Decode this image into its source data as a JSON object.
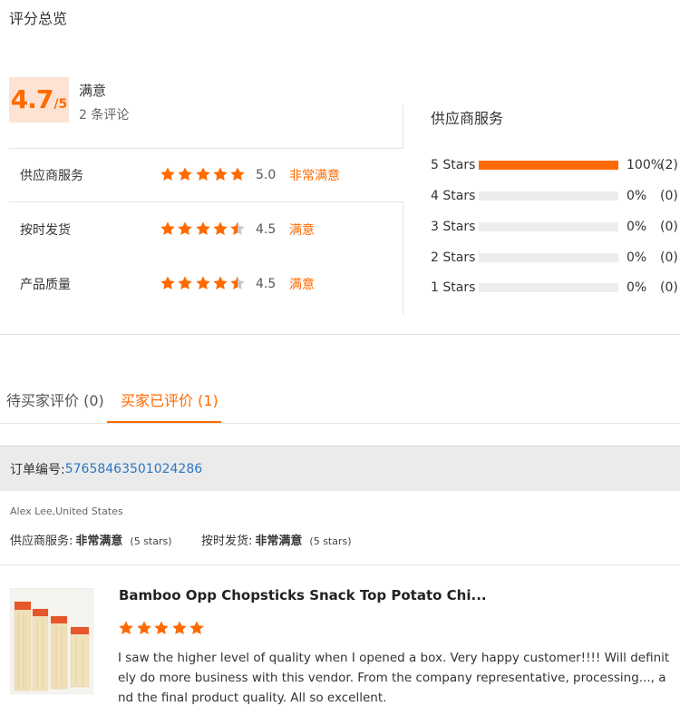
{
  "page_title": "评分总览",
  "summary": {
    "score": "4.7",
    "score_denominator": "/5",
    "score_word": "满意",
    "review_count": "2 条评论"
  },
  "ratings": [
    {
      "label": "供应商服务",
      "stars": 5.0,
      "value": "5.0",
      "text": "非常满意"
    },
    {
      "label": "按时发货",
      "stars": 4.5,
      "value": "4.5",
      "text": "满意"
    },
    {
      "label": "产品质量",
      "stars": 4.5,
      "value": "4.5",
      "text": "满意"
    }
  ],
  "distribution": {
    "title": "供应商服务",
    "rows": [
      {
        "label": "5  Stars",
        "fraction": 1.0,
        "percent": "100%",
        "count": "(2)"
      },
      {
        "label": "4  Stars",
        "fraction": 0.0,
        "percent": "0%",
        "count": "(0)"
      },
      {
        "label": "3  Stars",
        "fraction": 0.0,
        "percent": "0%",
        "count": "(0)"
      },
      {
        "label": "2  Stars",
        "fraction": 0.0,
        "percent": "0%",
        "count": "(0)"
      },
      {
        "label": "1  Stars",
        "fraction": 0.0,
        "percent": "0%",
        "count": "(0)"
      }
    ]
  },
  "tabs": [
    {
      "label": "待买家评价 (0)",
      "active": false
    },
    {
      "label": "买家已评价 (1)",
      "active": true
    }
  ],
  "order": {
    "label": "订单编号: ",
    "number": "57658463501024286"
  },
  "review": {
    "reviewer": "Alex Lee,United States",
    "meta": [
      {
        "label": "供应商服务:",
        "value": "非常满意",
        "stars_text": "(5 stars)"
      },
      {
        "label": "按时发货:",
        "value": "非常满意",
        "stars_text": "(5 stars)"
      }
    ],
    "product_title": "Bamboo Opp Chopsticks Snack Top Potato Chi...",
    "product_stars": 5,
    "text": "I saw the higher level of quality when I opened a box.  Very happy customer!!!! Will definitely do more business with this vendor.  From the company representative, processing..., and the final product quality. All so excellent."
  },
  "colors": {
    "accent": "#ff6a00",
    "link": "#2a78c4",
    "empty_bar": "#ededed"
  }
}
